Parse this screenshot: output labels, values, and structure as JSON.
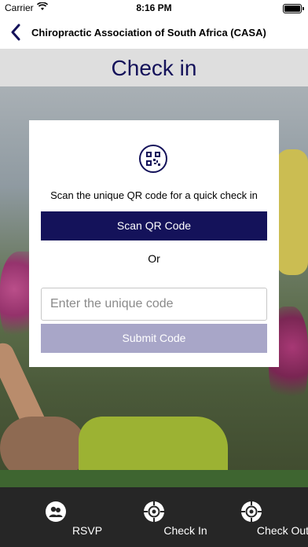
{
  "status_bar": {
    "carrier": "Carrier",
    "time": "8:16 PM"
  },
  "navbar": {
    "back_icon": "chevron-left-icon",
    "title": "Chiropractic Association of South Africa (CASA)"
  },
  "header": {
    "title": "Check in"
  },
  "checkin_card": {
    "qr_icon": "qr-code-icon",
    "scan_instruction": "Scan the unique QR code for a quick check in",
    "scan_button_label": "Scan QR Code",
    "or_text": "Or",
    "code_input": {
      "value": "",
      "placeholder": "Enter the unique code"
    },
    "submit_button_label": "Submit Code"
  },
  "tab_bar": {
    "items": [
      {
        "label": "RSVP",
        "icon": "people-icon"
      },
      {
        "label": "Check In",
        "icon": "crosshair-icon"
      },
      {
        "label": "Check Out",
        "icon": "crosshair-icon"
      }
    ]
  },
  "colors": {
    "primary": "#14125a",
    "submit_disabled": "#a8a6c8",
    "header_background": "#dedede",
    "tab_bar_background": "#262626"
  }
}
